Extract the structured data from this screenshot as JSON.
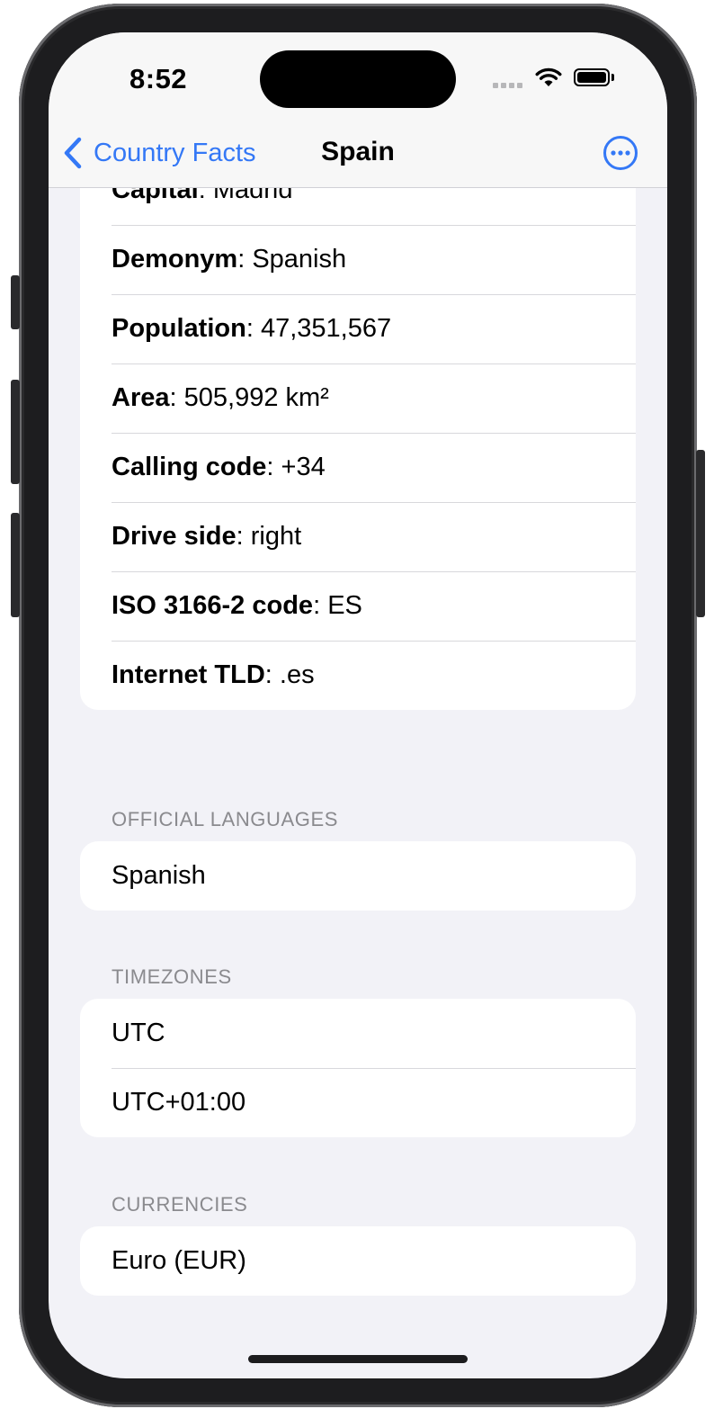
{
  "status_bar": {
    "time": "8:52"
  },
  "nav": {
    "back_label": "Country Facts",
    "title": "Spain"
  },
  "facts": [
    {
      "label": "Capital",
      "value": "Madrid"
    },
    {
      "label": "Demonym",
      "value": "Spanish"
    },
    {
      "label": "Population",
      "value": "47,351,567"
    },
    {
      "label": "Area",
      "value": "505,992 km²"
    },
    {
      "label": "Calling code",
      "value": "+34"
    },
    {
      "label": "Drive side",
      "value": "right"
    },
    {
      "label": "ISO 3166-2 code",
      "value": "ES"
    },
    {
      "label": "Internet TLD",
      "value": ".es"
    }
  ],
  "sections": {
    "languages": {
      "header": "OFFICIAL LANGUAGES",
      "items": [
        "Spanish"
      ]
    },
    "timezones": {
      "header": "TIMEZONES",
      "items": [
        "UTC",
        "UTC+01:00"
      ]
    },
    "currencies": {
      "header": "CURRENCIES",
      "items": [
        "Euro (EUR)"
      ]
    }
  },
  "colors": {
    "accent": "#3478f6",
    "background": "#f2f2f7",
    "card": "#ffffff",
    "secondary_text": "#8a8a8e"
  },
  "icons": {
    "back": "chevron-left-icon",
    "more": "ellipsis-circle-icon",
    "wifi": "wifi-icon",
    "battery": "battery-icon",
    "signal": "cellular-signal-icon"
  }
}
